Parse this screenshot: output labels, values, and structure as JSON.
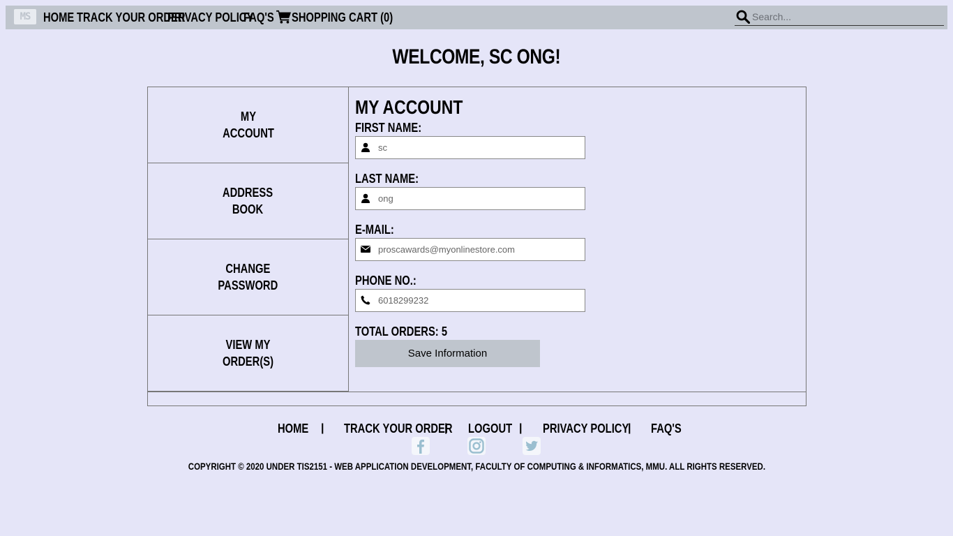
{
  "navbar": {
    "logo_text": "MS",
    "links": [
      "HOME",
      "TRACK YOUR ORDER",
      "PRIVACY POLICY",
      "FAQ'S"
    ],
    "cart_label": "SHOPPING CART (0)",
    "search_placeholder": "Search..."
  },
  "welcome": "WELCOME, SC ONG!",
  "sidebar": {
    "items": [
      {
        "label": "MY\nACCOUNT"
      },
      {
        "label": "ADDRESS\nBOOK"
      },
      {
        "label": "CHANGE\nPASSWORD"
      },
      {
        "label": "VIEW MY\nORDER(S)"
      }
    ]
  },
  "account": {
    "title": "MY ACCOUNT",
    "first_name_label": "FIRST NAME:",
    "first_name_value": "sc",
    "last_name_label": "LAST NAME:",
    "last_name_value": "ong",
    "email_label": "E-MAIL:",
    "email_value": "proscawards@myonlinestore.com",
    "phone_label": "PHONE NO.:",
    "phone_value": "6018299232",
    "total_orders": "TOTAL ORDERS: 5",
    "save_label": "Save Information"
  },
  "footer": {
    "links": [
      "HOME",
      "TRACK YOUR ORDER",
      "LOGOUT",
      "PRIVACY POLICY",
      "FAQ'S"
    ],
    "separator": "|",
    "social": [
      "facebook-icon",
      "instagram-icon",
      "twitter-icon"
    ],
    "copyright": "COPYRIGHT © 2020 UNDER TIS2151 - WEB APPLICATION DEVELOPMENT, FACULTY OF COMPUTING & INFORMATICS, MMU. ALL RIGHTS RESERVED."
  },
  "colors": {
    "background": "#e5e5f8",
    "navbar": "#bfc5cd",
    "button": "#bfc5cd",
    "social_icon": "#9bbfd0"
  }
}
